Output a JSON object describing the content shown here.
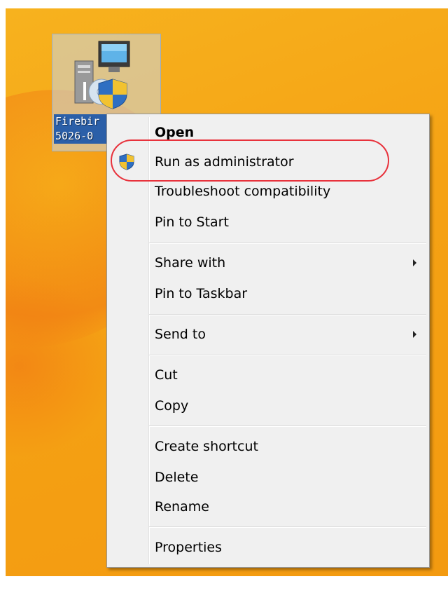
{
  "desktop": {
    "file_icon": {
      "label_line1": "Firebir",
      "label_line2": "5026-0"
    }
  },
  "context_menu": {
    "items": [
      {
        "label": "Open",
        "bold": true
      },
      {
        "label": "Run as administrator",
        "icon": "uac-shield-icon",
        "highlighted": true
      },
      {
        "label": "Troubleshoot compatibility"
      },
      {
        "label": "Pin to Start"
      },
      {
        "label": "Share with",
        "submenu": true
      },
      {
        "label": "Pin to Taskbar"
      },
      {
        "label": "Send to",
        "submenu": true
      },
      {
        "label": "Cut"
      },
      {
        "label": "Copy"
      },
      {
        "label": "Create shortcut"
      },
      {
        "label": "Delete"
      },
      {
        "label": "Rename"
      },
      {
        "label": "Properties"
      }
    ]
  },
  "colors": {
    "desktop_background": "#f5a214",
    "menu_background": "#f0f0f0",
    "annotation_ellipse": "#e8323c"
  }
}
